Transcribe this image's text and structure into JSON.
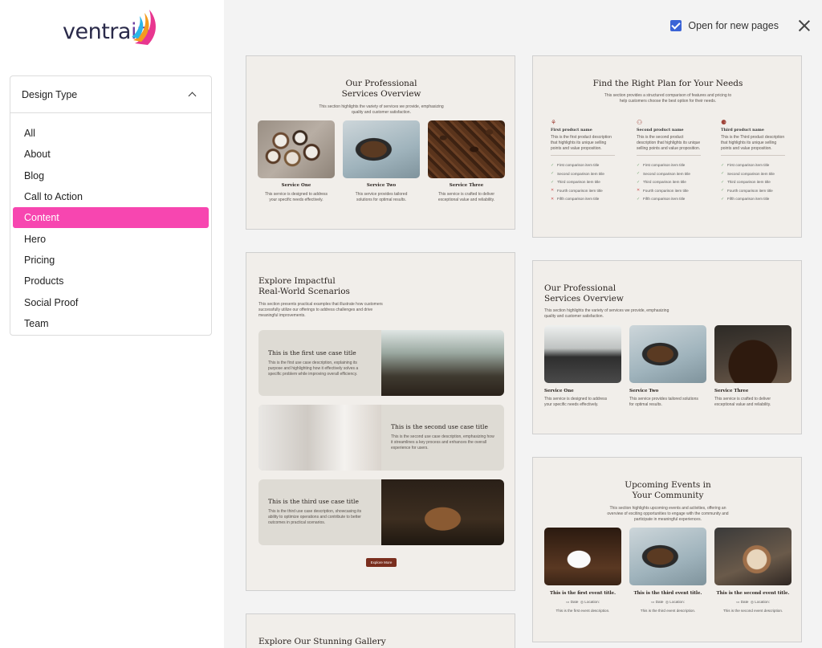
{
  "sidebar": {
    "logo": {
      "text_main": "ventra",
      "text_accent": "ip"
    },
    "panel_title": "Design Type",
    "filters": [
      "All",
      "About",
      "Blog",
      "Call to Action",
      "Content",
      "Hero",
      "Pricing",
      "Products",
      "Social Proof",
      "Team"
    ],
    "active_filter": "Content"
  },
  "topbar": {
    "open_label": "Open for new pages",
    "checked": true
  },
  "cards": {
    "services1": {
      "title_line1": "Our Professional",
      "title_line2": "Services Overview",
      "subtitle": "This section highlights the variety of services we provide, emphasizing quality and customer satisfaction.",
      "items": [
        {
          "name": "Service One",
          "desc": "This service is designed to address your specific needs effectively."
        },
        {
          "name": "Service Two",
          "desc": "This service provides tailored solutions for optimal results."
        },
        {
          "name": "Service Three",
          "desc": "This service is crafted to deliver exceptional value and reliability."
        }
      ]
    },
    "plans": {
      "title": "Find the Right Plan for Your Needs",
      "subtitle": "This section provides a structured comparison of features and pricing to help customers choose the best option for their needs.",
      "columns": [
        {
          "name": "First product name",
          "desc": "This is the first product description that highlights its unique selling points and value proposition.",
          "items": [
            "First comparison item title",
            "Second comparison item title",
            "Third comparison item title",
            "Fourth comparison item title",
            "Fifth comparison item title"
          ],
          "marks": [
            "check",
            "check",
            "check",
            "x",
            "x"
          ]
        },
        {
          "name": "Second product name",
          "desc": "This is the second product description that highlights its unique selling points and value proposition.",
          "items": [
            "First comparison item title",
            "Second comparison item title",
            "Third comparison item title",
            "Fourth comparison item title",
            "Fifth comparison item title"
          ],
          "marks": [
            "check",
            "check",
            "check",
            "x",
            "check"
          ]
        },
        {
          "name": "Third product name",
          "desc": "This is the Third product description that highlights its unique selling points and value proposition.",
          "items": [
            "First comparison item title",
            "Second comparison item title",
            "Third comparison item title",
            "Fourth comparison item title",
            "Fifth comparison item title"
          ],
          "marks": [
            "check",
            "check",
            "check",
            "check",
            "check"
          ]
        }
      ]
    },
    "scenarios": {
      "title_line1": "Explore Impactful",
      "title_line2": "Real-World Scenarios",
      "subtitle": "This section presents practical examples that illustrate how customers successfully utilize our offerings to address challenges and drive meaningful improvements.",
      "cases": [
        {
          "title": "This is the first use case title",
          "desc": "This is the first use case description, explaining its purpose and highlighting how it effectively solves a specific problem while improving overall efficiency."
        },
        {
          "title": "This is the second use case title",
          "desc": "This is the second use case description, emphasizing how it streamlines a key process and enhances the overall experience for users."
        },
        {
          "title": "This is the third use case title",
          "desc": "This is the third use case description, showcasing its ability to optimize operations and contribute to better outcomes in practical scenarios."
        }
      ],
      "button": "Explore More"
    },
    "services2": {
      "title_line1": "Our Professional",
      "title_line2": "Services Overview",
      "subtitle": "This section highlights the variety of services we provide, emphasizing quality and customer satisfaction.",
      "items": [
        {
          "name": "Service One",
          "desc": "This service is designed to address your specific needs effectively."
        },
        {
          "name": "Service Two",
          "desc": "This service provides tailored solutions for optimal results."
        },
        {
          "name": "Service Three",
          "desc": "This service is crafted to deliver exceptional value and reliability."
        }
      ]
    },
    "events": {
      "title_line1": "Upcoming Events in",
      "title_line2": "Your Community",
      "subtitle": "This section highlights upcoming events and activities, offering an overview of exciting opportunities to engage with the community and participate in meaningful experiences.",
      "items": [
        {
          "title": "This is the first event title.",
          "date": "Date",
          "location": "Location",
          "desc": "This is the first event description."
        },
        {
          "title": "This is the third event title.",
          "date": "Date",
          "location": "Location",
          "desc": "This is the third event description."
        },
        {
          "title": "This is the second event title.",
          "date": "Date",
          "location": "Location",
          "desc": "This is the second event description."
        }
      ]
    },
    "gallery": {
      "title": "Explore Our Stunning Gallery"
    }
  }
}
